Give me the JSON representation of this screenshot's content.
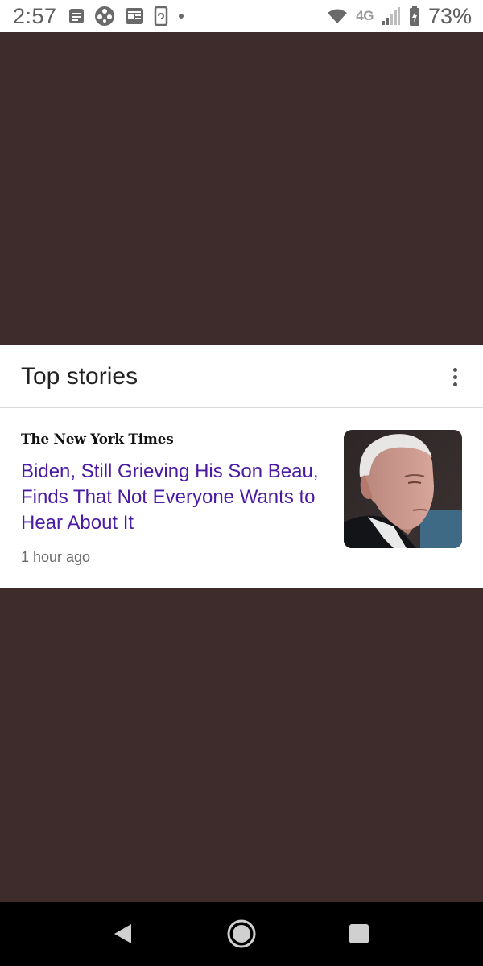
{
  "status_bar": {
    "time": "2:57",
    "network": "4G",
    "battery_percent": "73%",
    "icons": [
      "news-icon",
      "pinwheel-icon",
      "article-icon",
      "sync-icon",
      "dot-icon",
      "wifi-icon",
      "signal-icon",
      "battery-icon"
    ]
  },
  "card": {
    "title": "Top stories",
    "story": {
      "publisher": "The New York Times",
      "headline": "Biden, Still Grieving His Son Beau, Finds That Not Everyone Wants to Hear About It",
      "timestamp": "1 hour ago"
    }
  },
  "nav_bar": {
    "buttons": [
      "back-button",
      "home-button",
      "recents-button"
    ]
  },
  "colors": {
    "background": "#3e2b2b",
    "headline_link": "#4b1aa3",
    "card": "#ffffff"
  }
}
